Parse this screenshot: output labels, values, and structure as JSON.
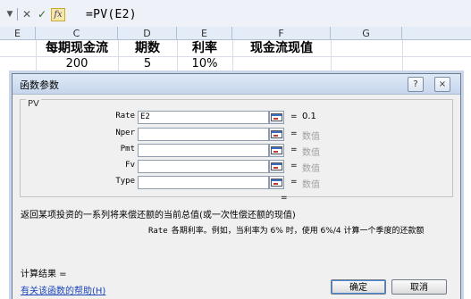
{
  "formula_bar": {
    "cancel_icon": "close-icon",
    "enter_icon": "check-icon",
    "fx_label": "fx",
    "formula": "=PV(E2)"
  },
  "sheet": {
    "columns": [
      "E",
      "C",
      "D",
      "E",
      "F",
      "G"
    ],
    "row2": {
      "c": "每期现金流",
      "d": "期数",
      "e": "利率",
      "f": "现金流现值"
    },
    "row3": {
      "c": "200",
      "d": "5",
      "e": "10%"
    }
  },
  "dialog": {
    "title": "函数参数",
    "help_button": "?",
    "close_button": "×",
    "function_name": "PV",
    "args": [
      {
        "label": "Rate",
        "value": "E2",
        "result": "0.1"
      },
      {
        "label": "Nper",
        "value": "",
        "result": "数值"
      },
      {
        "label": "Pmt",
        "value": "",
        "result": "数值"
      },
      {
        "label": "Fv",
        "value": "",
        "result": "数值"
      },
      {
        "label": "Type",
        "value": "",
        "result": "数值"
      }
    ],
    "equals": "=",
    "result_equals": "=",
    "description": "返回某项投资的一系列将来偿还额的当前总值(或一次性偿还额的现值)",
    "arg_desc_name": "Rate",
    "arg_desc_text": "各期利率。例如，当利率为 6% 时，使用 6%/4 计算一个季度的还款额",
    "calc_result": "计算结果 =",
    "help_link": "有关该函数的帮助(H)",
    "ok": "确定",
    "cancel": "取消"
  }
}
